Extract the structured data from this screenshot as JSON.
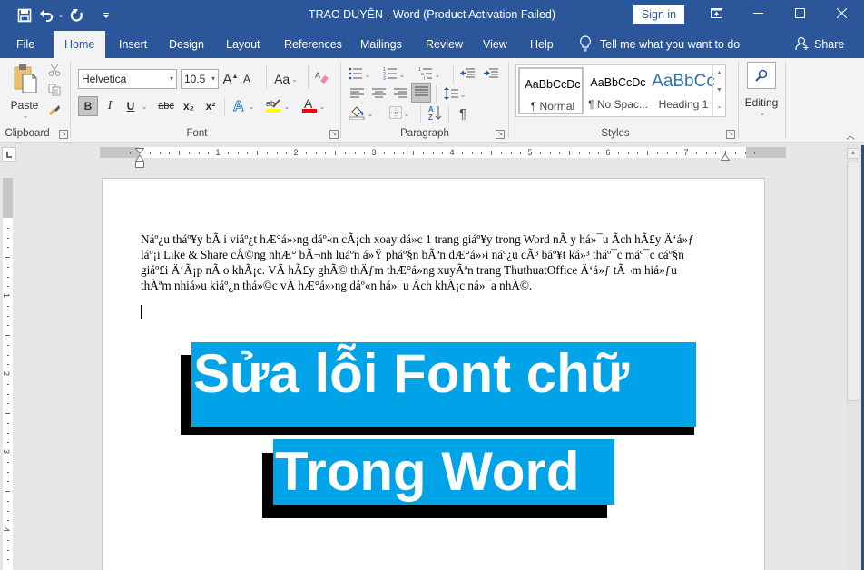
{
  "titlebar": {
    "title": "TRAO DUYÊN  -  Word (Product Activation Failed)",
    "sign_in": "Sign in",
    "qat": [
      "save-icon",
      "undo-icon",
      "redo-icon",
      "customize-qat-icon"
    ],
    "window_buttons": [
      "ribbon-display-options-icon",
      "minimize-icon",
      "maximize-icon",
      "close-icon"
    ]
  },
  "tabs": [
    {
      "label": "File",
      "active": false
    },
    {
      "label": "Home",
      "active": true
    },
    {
      "label": "Insert",
      "active": false
    },
    {
      "label": "Design",
      "active": false
    },
    {
      "label": "Layout",
      "active": false
    },
    {
      "label": "References",
      "active": false
    },
    {
      "label": "Mailings",
      "active": false
    },
    {
      "label": "Review",
      "active": false
    },
    {
      "label": "View",
      "active": false
    },
    {
      "label": "Help",
      "active": false
    }
  ],
  "tell_me": "Tell me what you want to do",
  "share": "Share",
  "ribbon": {
    "clipboard": {
      "label": "Clipboard",
      "paste": "Paste"
    },
    "font": {
      "label": "Font",
      "font_name": "Helvetica",
      "font_size": "10.5",
      "change_case": "Aa",
      "bold": "B",
      "italic": "I",
      "underline": "U",
      "strikethrough": "abc",
      "subscript": "x₂",
      "superscript": "x²",
      "highlight_color": "#ffff00",
      "font_color": "#ff0000"
    },
    "paragraph": {
      "label": "Paragraph"
    },
    "styles": {
      "label": "Styles",
      "items": [
        {
          "preview": "AaBbCcDc",
          "name": "¶ Normal",
          "selected": true
        },
        {
          "preview": "AaBbCcDc",
          "name": "¶ No Spac...",
          "selected": false
        },
        {
          "preview": "AaBbCc",
          "name": "Heading 1",
          "selected": false
        }
      ]
    },
    "editing": {
      "label": "Editing"
    }
  },
  "ruler": {
    "h_numbers": [
      "1",
      "2",
      "3",
      "4",
      "5",
      "6",
      "7"
    ],
    "v_numbers": [
      "1",
      "2",
      "3",
      "4"
    ]
  },
  "document": {
    "garbled_text": "Náº¿u tháº¥y bÃ i viáº¿t hÆ°á»›ng dáº«n cÃ¡ch xoay dá»\u0010c 1 trang giáº¥y trong Word nÃ y há»¯u Ãch hÃ£y Ä‘á»ƒ láº¡i Like & Share cÅ©ng nhÆ° bÃ¬nh luáº­n á»Ÿ pháº§n bÃªn dÆ°á»›i náº¿u cÃ³ báº¥t ká»³ tháº¯c máº¯c cáº§n giáº£i Ä‘Ã¡p nÃ o khÃ¡c. VÃ  hÃ£y ghÃ© thÄƒm thÆ°á»\u0010ng xuyÃªn trang ThuthuatOffice Ä‘á»ƒ tÃ¬m hiá»ƒu thÃªm nhiá»\u0010u kiáº¿n thá»©c vÃ  hÆ°á»›ng dáº«n há»¯u Ãch khÃ¡c ná»¯a nhÃ©.",
    "banner_line1": "Sửa lỗi Font chữ",
    "banner_line2": "Trong Word",
    "banner_color": "#00a2e8"
  },
  "colors": {
    "word_blue": "#2b579a",
    "ribbon_bg": "#f3f3f3"
  }
}
